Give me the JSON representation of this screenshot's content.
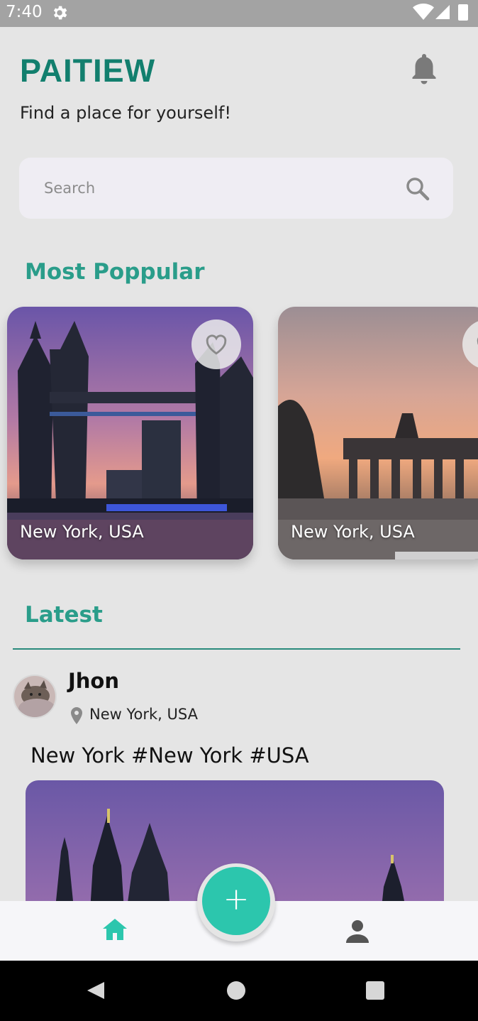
{
  "status_bar": {
    "time": "7:40"
  },
  "app": {
    "brand": "PAITIEW",
    "tagline": "Find a place for yourself!"
  },
  "search": {
    "placeholder": "Search"
  },
  "sections": {
    "popular": "Most Poppular",
    "latest": "Latest"
  },
  "popular_cards": [
    {
      "location": "New York, USA"
    },
    {
      "location": "New York, USA"
    }
  ],
  "post": {
    "author": "Jhon",
    "location": "New York, USA",
    "text": "New York #New York #USA"
  },
  "fab": {
    "label": "+"
  },
  "colors": {
    "brand": "#127f6e",
    "accent": "#2a9d8a",
    "fab": "#2cc6ad"
  }
}
